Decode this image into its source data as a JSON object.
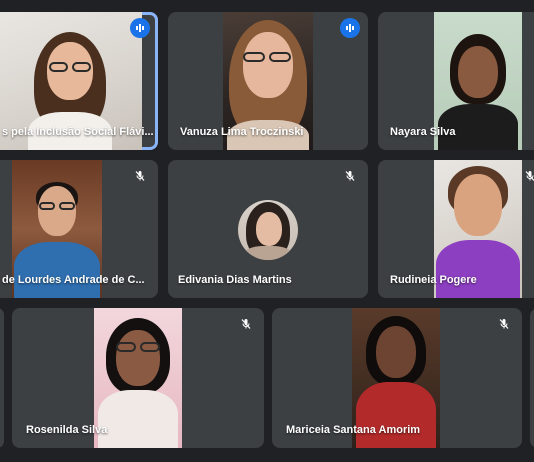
{
  "participants": [
    {
      "name": "s pela Inclusão Social Flávi...",
      "status": "speaking"
    },
    {
      "name": "Vanuza Lima Troczinski",
      "status": "speaking"
    },
    {
      "name": "Nayara Silva",
      "status": "none"
    },
    {
      "name": "de Lourdes Andrade de C...",
      "status": "muted"
    },
    {
      "name": "Edivania Dias Martins",
      "status": "muted"
    },
    {
      "name": "Rudineia Pogere",
      "status": "muted"
    },
    {
      "name": "Rosenilda Silva",
      "status": "muted"
    },
    {
      "name": "Mariceia Santana Amorim",
      "status": "muted"
    }
  ],
  "icons": {
    "speaking": "audio-level-icon",
    "muted": "mic-off-icon"
  },
  "colors": {
    "background": "#202124",
    "tile": "#3c4043",
    "active_border": "#8ab4f8",
    "speaking_badge": "#1a73e8"
  }
}
